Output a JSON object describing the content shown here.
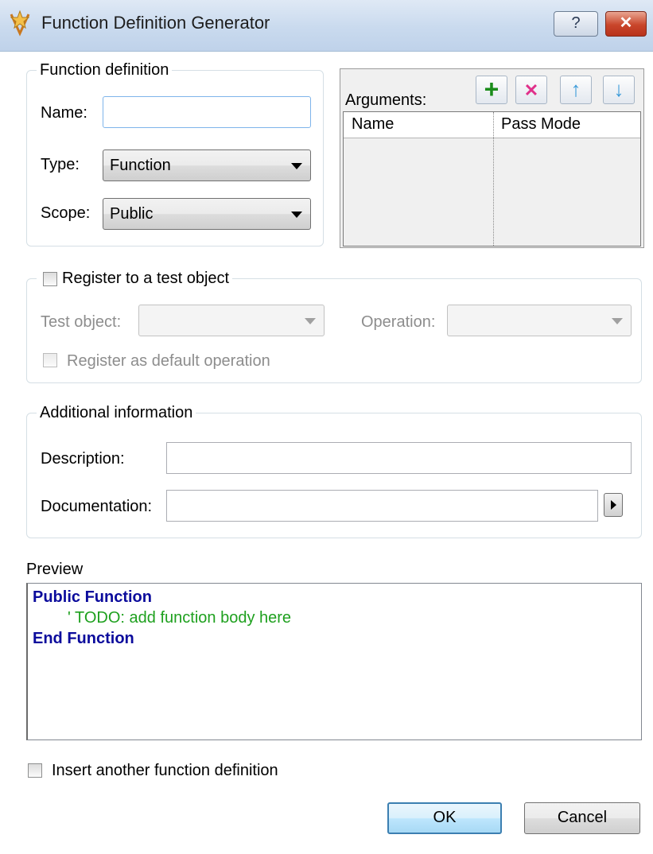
{
  "window": {
    "title": "Function Definition Generator",
    "help_glyph": "?",
    "close_glyph": "✕",
    "title_icon": "function-wizard-icon"
  },
  "function_definition": {
    "legend": "Function definition",
    "name_label": "Name:",
    "name_value": "",
    "type_label": "Type:",
    "type_value": "Function",
    "scope_label": "Scope:",
    "scope_value": "Public"
  },
  "arguments": {
    "label": "Arguments:",
    "toolbar": [
      {
        "icon": "add-icon",
        "glyph": "+",
        "color": "#1a8c1a"
      },
      {
        "icon": "delete-icon",
        "glyph": "✕",
        "color": "#e0308a"
      },
      {
        "icon": "move-up-icon",
        "glyph": "↑",
        "color": "#3a9ad9"
      },
      {
        "icon": "move-down-icon",
        "glyph": "↓",
        "color": "#3a9ad9"
      }
    ],
    "columns": [
      "Name",
      "Pass Mode"
    ],
    "rows": []
  },
  "register": {
    "legend": "Register to a test object",
    "checked": false,
    "test_object_label": "Test object:",
    "test_object_value": "",
    "operation_label": "Operation:",
    "operation_value": "",
    "default_label": "Register as default operation",
    "default_checked": false
  },
  "additional": {
    "legend": "Additional information",
    "description_label": "Description:",
    "description_value": "",
    "documentation_label": "Documentation:",
    "documentation_value": ""
  },
  "preview": {
    "label": "Preview",
    "line1": "Public Function",
    "line2": "' TODO: add function body here",
    "line3": "End Function",
    "keyword_color": "#0b0b9c",
    "comment_color": "#1ea01e"
  },
  "insert_another": {
    "label": "Insert another function definition",
    "checked": false
  },
  "buttons": {
    "ok": "OK",
    "cancel": "Cancel"
  }
}
